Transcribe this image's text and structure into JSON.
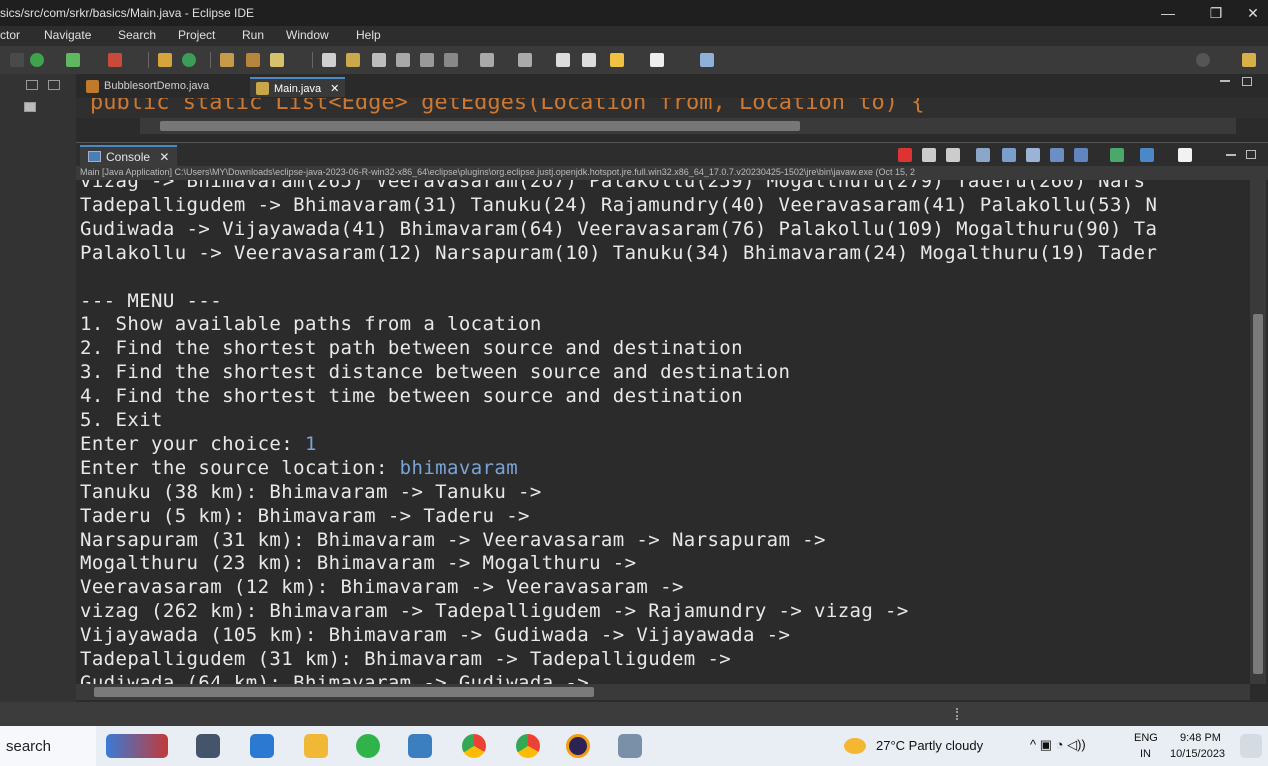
{
  "window": {
    "title": "sics/src/com/srkr/basics/Main.java - Eclipse IDE",
    "min": "—",
    "max": "❐",
    "close": "✕"
  },
  "menu": [
    "ctor",
    "Navigate",
    "Search",
    "Project",
    "Run",
    "Window",
    "Help"
  ],
  "editor": {
    "tabs": [
      {
        "label": "BubblesortDemo.java",
        "active": false
      },
      {
        "label": "Main.java",
        "active": true
      }
    ],
    "close_glyph": "✕",
    "code_line": "public static List<Edge> getEdges(Location from, Location to) {"
  },
  "console": {
    "tab_label": "Console",
    "path": "Main [Java Application] C:\\Users\\MY\\Downloads\\eclipse-java-2023-06-R-win32-x86_64\\eclipse\\plugins\\org.eclipse.justj.openjdk.hotspot.jre.full.win32.x86_64_17.0.7.v20230425-1502\\jre\\bin\\javaw.exe  (Oct 15, 2",
    "lines": [
      {
        "text": "vizag -> Bhimavaram(265) Veeravasaram(267) Palakollu(259) Mogalthuru(279) Taderu(260) Nars",
        "cls": ""
      },
      {
        "text": "Tadepalligudem -> Bhimavaram(31) Tanuku(24) Rajamundry(40) Veeravasaram(41) Palakollu(53) N",
        "cls": ""
      },
      {
        "text": "Gudiwada -> Vijayawada(41) Bhimavaram(64) Veeravasaram(76) Palakollu(109) Mogalthuru(90) Ta",
        "cls": ""
      },
      {
        "text": "Palakollu -> Veeravasaram(12) Narsapuram(10) Tanuku(34) Bhimavaram(24) Mogalthuru(19) Tader",
        "cls": ""
      },
      {
        "text": "",
        "cls": ""
      },
      {
        "text": "--- MENU ---",
        "cls": ""
      },
      {
        "text": "1. Show available paths from a location",
        "cls": ""
      },
      {
        "text": "2. Find the shortest path between source and destination",
        "cls": ""
      },
      {
        "text": "3. Find the shortest distance between source and destination",
        "cls": ""
      },
      {
        "text": "4. Find the shortest time between source and destination",
        "cls": ""
      },
      {
        "text": "5. Exit",
        "cls": ""
      },
      {
        "text": "Enter your choice: ",
        "input": "1"
      },
      {
        "text": "Enter the source location: ",
        "input": "bhimavaram"
      },
      {
        "text": "Tanuku (38 km): Bhimavaram -> Tanuku ->",
        "cls": ""
      },
      {
        "text": "Taderu (5 km): Bhimavaram -> Taderu ->",
        "cls": ""
      },
      {
        "text": "Narsapuram (31 km): Bhimavaram -> Veeravasaram -> Narsapuram ->",
        "cls": ""
      },
      {
        "text": "Mogalthuru (23 km): Bhimavaram -> Mogalthuru ->",
        "cls": ""
      },
      {
        "text": "Veeravasaram (12 km): Bhimavaram -> Veeravasaram ->",
        "cls": ""
      },
      {
        "text": "vizag (262 km): Bhimavaram -> Tadepalligudem -> Rajamundry -> vizag ->",
        "cls": ""
      },
      {
        "text": "Vijayawada (105 km): Bhimavaram -> Gudiwada -> Vijayawada ->",
        "cls": ""
      },
      {
        "text": "Tadepalligudem (31 km): Bhimavaram -> Tadepalligudem ->",
        "cls": ""
      },
      {
        "text": "Gudiwada (64 km): Bhimavaram -> Gudiwada ->",
        "cls": ""
      }
    ]
  },
  "taskbar": {
    "search_label": "search",
    "weather": "27°C  Partly cloudy",
    "lang_top": "ENG",
    "lang_bottom": "IN",
    "time": "9:48 PM",
    "date": "10/15/2023"
  }
}
